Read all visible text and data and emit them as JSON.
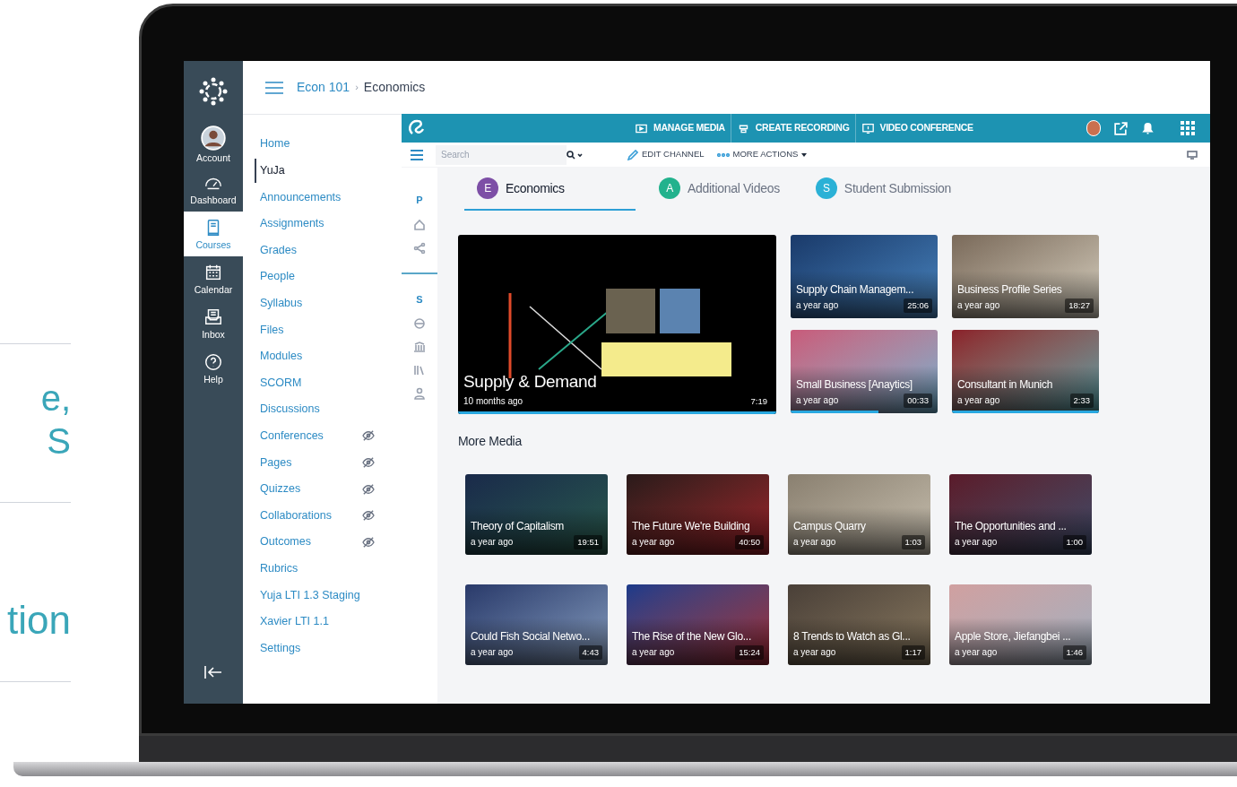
{
  "marketing_text": [
    "e,",
    "S",
    "tion"
  ],
  "global_nav": {
    "items": [
      {
        "label": "Account",
        "selected": false
      },
      {
        "label": "Dashboard",
        "selected": false
      },
      {
        "label": "Courses",
        "selected": true
      },
      {
        "label": "Calendar",
        "selected": false
      },
      {
        "label": "Inbox",
        "selected": false
      },
      {
        "label": "Help",
        "selected": false
      }
    ]
  },
  "breadcrumb": [
    "Econ 101",
    "›",
    "Economics"
  ],
  "course_nav": [
    {
      "label": "Home",
      "selected": false,
      "hidden": false
    },
    {
      "label": "YuJa",
      "selected": true,
      "hidden": false
    },
    {
      "label": "Announcements",
      "selected": false,
      "hidden": false
    },
    {
      "label": "Assignments",
      "selected": false,
      "hidden": false
    },
    {
      "label": "Grades",
      "selected": false,
      "hidden": false
    },
    {
      "label": "People",
      "selected": false,
      "hidden": false
    },
    {
      "label": "Syllabus",
      "selected": false,
      "hidden": false
    },
    {
      "label": "Files",
      "selected": false,
      "hidden": false
    },
    {
      "label": "Modules",
      "selected": false,
      "hidden": false
    },
    {
      "label": "SCORM",
      "selected": false,
      "hidden": false
    },
    {
      "label": "Discussions",
      "selected": false,
      "hidden": false
    },
    {
      "label": "Conferences",
      "selected": false,
      "hidden": true
    },
    {
      "label": "Pages",
      "selected": false,
      "hidden": true
    },
    {
      "label": "Quizzes",
      "selected": false,
      "hidden": true
    },
    {
      "label": "Collaborations",
      "selected": false,
      "hidden": true
    },
    {
      "label": "Outcomes",
      "selected": false,
      "hidden": true
    },
    {
      "label": "Rubrics",
      "selected": false,
      "hidden": false
    },
    {
      "label": "Yuja LTI 1.3 Staging",
      "selected": false,
      "hidden": false
    },
    {
      "label": "Xavier LTI 1.1",
      "selected": false,
      "hidden": false
    },
    {
      "label": "Settings",
      "selected": false,
      "hidden": false
    }
  ],
  "yuja": {
    "top_actions": [
      "MANAGE MEDIA",
      "CREATE RECORDING",
      "VIDEO CONFERENCE"
    ],
    "search": {
      "placeholder": "Search"
    },
    "toolbar": [
      "EDIT CHANNEL",
      "MORE ACTIONS"
    ],
    "rail_letters": [
      "P",
      "S"
    ],
    "tabs": [
      {
        "letter": "E",
        "label": "Economics",
        "color": "#7d4fa6",
        "selected": true
      },
      {
        "letter": "A",
        "label": "Additional Videos",
        "color": "#22b28d",
        "selected": false
      },
      {
        "letter": "S",
        "label": "Student Submission",
        "color": "#2bb1d6",
        "selected": false
      }
    ],
    "featured": {
      "title": "Supply & Demand",
      "age": "10 months ago",
      "duration": "7:19",
      "level": 1
    },
    "videos": [
      {
        "title": "Supply Chain Managem...",
        "age": "a year ago",
        "duration": "25:06"
      },
      {
        "title": "Business Profile Series",
        "age": "a year ago",
        "duration": "18:27"
      },
      {
        "title": "Small Business [Anaytics]",
        "age": "a year ago",
        "duration": "00:33",
        "level": 0.6
      },
      {
        "title": "Consultant in Munich",
        "age": "a year ago",
        "duration": "2:33",
        "level": 1
      }
    ],
    "more_media": {
      "heading": "More Media",
      "videos": [
        {
          "title": "Theory of Capitalism",
          "age": "a year ago",
          "duration": "19:51"
        },
        {
          "title": "The Future We're Building",
          "age": "a year ago",
          "duration": "40:50"
        },
        {
          "title": "Campus Quarry",
          "age": "a year ago",
          "duration": "1:03"
        },
        {
          "title": "The Opportunities and ...",
          "age": "a year ago",
          "duration": "1:00"
        },
        {
          "title": "Could Fish Social Netwo...",
          "age": "a year ago",
          "duration": "4:43"
        },
        {
          "title": "The Rise of the New Glo...",
          "age": "a year ago",
          "duration": "15:24"
        },
        {
          "title": "8 Trends to Watch as Gl...",
          "age": "a year ago",
          "duration": "1:17"
        },
        {
          "title": "Apple Store, Jiefangbei ...",
          "age": "a year ago",
          "duration": "1:46"
        }
      ]
    }
  }
}
